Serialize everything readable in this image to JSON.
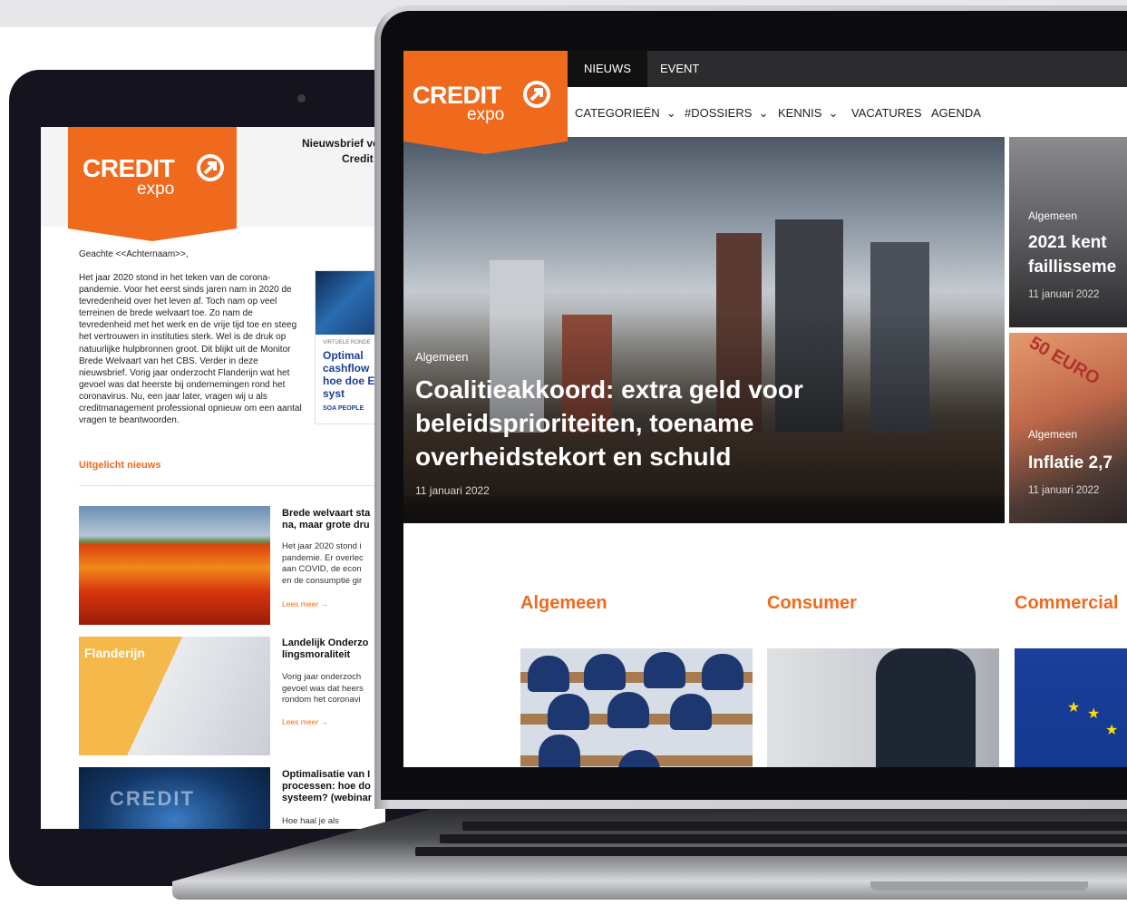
{
  "newsletter": {
    "logo_word": "CREDIT",
    "logo_sub": "expo",
    "title_line1": "Nieuwsbrief voc",
    "title_line2": "Credit M",
    "greeting": "Geachte <<Achternaam>>,",
    "intro": "Het jaar 2020 stond in het teken van de corona-pandemie. Voor het eerst sinds jaren nam in 2020 de tevredenheid over het leven af. Toch nam op veel terreinen de brede welvaart toe. Zo nam de tevredenheid met het werk en de vrije tijd toe en steeg het vertrouwen in instituties sterk. Wel is de druk op natuurlijke hulpbronnen groot. Dit blijkt uit de Monitor Brede Welvaart van het CBS. Verder in deze nieuwsbrief. Vorig jaar onderzocht Flanderijn wat het gevoel was dat heerste bij ondernemingen rond het coronavirus. Nu, een jaar later, vragen wij u als creditmanagement professional opnieuw om een aantal vragen te beantwoorden.",
    "ad": {
      "kicker": "VIRTUELE RONDE",
      "title": "Optimal cashflow hoe doe ERP syst",
      "brand": "SOA PEOPLE"
    },
    "section_title": "Uitgelicht nieuws",
    "items": [
      {
        "title_l1": "Brede welvaart sta",
        "title_l2": "na, maar grote dru",
        "text_l1": "Het jaar 2020 stond i",
        "text_l2": "pandemie. Er overlec",
        "text_l3": "aan COVID, de econ",
        "text_l4": "en de consumptie gir",
        "link": "Lees meer →"
      },
      {
        "image_label": "Flanderijn",
        "title_l1": "Landelijk Onderzo",
        "title_l2": "lingsmoraliteit",
        "text_l1": "Vorig jaar onderzoch",
        "text_l2": "gevoel was dat heers",
        "text_l3": "rondom het coronavi",
        "link": "Lees meer →"
      },
      {
        "image_label": "CREDIT",
        "title_l1": "Optimalisatie van I",
        "title_l2": "processen: hoe do",
        "title_l3": "systeem? (webinar",
        "text_l1": "Hoe haal je als"
      }
    ]
  },
  "site": {
    "logo_word": "CREDIT",
    "logo_sub": "expo",
    "top_tabs": [
      "NIEUWS",
      "EVENT"
    ],
    "nav": {
      "categories": "CATEGORIEËN",
      "dossiers": "#DOSSIERS",
      "kennis": "KENNIS",
      "vacatures": "VACATURES",
      "agenda": "AGENDA"
    },
    "hero": {
      "category": "Algemeen",
      "title": "Coalitieakkoord: extra geld voor beleidsprioriteiten, toename overheidstekort en schuld",
      "date": "11 januari 2022"
    },
    "side_cards": [
      {
        "category": "Algemeen",
        "title_l1": "2021 kent",
        "title_l2": "faillisseme",
        "date": "11 januari 2022"
      },
      {
        "category": "Algemeen",
        "title_l1": "Inflatie 2,7",
        "image_label": "50 EURO",
        "date": "11 januari 2022"
      }
    ],
    "sections": [
      "Algemeen",
      "Consumer",
      "Commercial"
    ]
  },
  "colors": {
    "brand_orange": "#f06a1e",
    "dark_bar": "#2c2c2e"
  }
}
